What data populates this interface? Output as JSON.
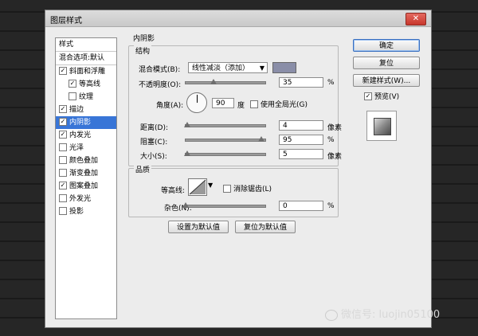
{
  "dialog": {
    "title": "图层样式",
    "close": "✕"
  },
  "styles_list": {
    "header": "样式",
    "blend_default": "混合选项:默认",
    "items": [
      {
        "label": "斜面和浮雕",
        "checked": true,
        "selected": false,
        "indent": 0
      },
      {
        "label": "等高线",
        "checked": true,
        "selected": false,
        "indent": 1
      },
      {
        "label": "纹理",
        "checked": false,
        "selected": false,
        "indent": 1
      },
      {
        "label": "描边",
        "checked": true,
        "selected": false,
        "indent": 0
      },
      {
        "label": "内阴影",
        "checked": true,
        "selected": true,
        "indent": 0
      },
      {
        "label": "内发光",
        "checked": true,
        "selected": false,
        "indent": 0
      },
      {
        "label": "光泽",
        "checked": false,
        "selected": false,
        "indent": 0
      },
      {
        "label": "颜色叠加",
        "checked": false,
        "selected": false,
        "indent": 0
      },
      {
        "label": "渐变叠加",
        "checked": false,
        "selected": false,
        "indent": 0
      },
      {
        "label": "图案叠加",
        "checked": true,
        "selected": false,
        "indent": 0
      },
      {
        "label": "外发光",
        "checked": false,
        "selected": false,
        "indent": 0
      },
      {
        "label": "投影",
        "checked": false,
        "selected": false,
        "indent": 0
      }
    ]
  },
  "inner_shadow": {
    "title": "内阴影",
    "structure": {
      "title": "结构",
      "blend_mode_label": "混合模式(B):",
      "blend_mode_value": "线性减淡（添加）",
      "swatch_color": "#8a8ea8",
      "opacity_label": "不透明度(O):",
      "opacity_value": "35",
      "opacity_unit": "%",
      "opacity_level": 0.35,
      "angle_label": "角度(A):",
      "angle_value": "90",
      "angle_unit": "度",
      "global_light_label": "使用全局光(G)",
      "global_light_checked": false,
      "distance_label": "距离(D):",
      "distance_value": "4",
      "distance_unit": "像素",
      "distance_level": 0.02,
      "choke_label": "阻塞(C):",
      "choke_value": "95",
      "choke_unit": "%",
      "choke_level": 0.95,
      "size_label": "大小(S):",
      "size_value": "5",
      "size_unit": "像素",
      "size_level": 0.02
    },
    "quality": {
      "title": "品质",
      "contour_label": "等高线:",
      "antialias_label": "消除锯齿(L)",
      "antialias_checked": false,
      "noise_label": "杂色(N):",
      "noise_value": "0",
      "noise_unit": "%",
      "noise_level": 0
    },
    "set_default_label": "设置为默认值",
    "reset_default_label": "复位为默认值"
  },
  "buttons": {
    "ok": "确定",
    "reset": "复位",
    "new_style": "新建样式(W)...",
    "preview_label": "预览(V)",
    "preview_checked": true
  },
  "watermark": "微信号: luojin05100"
}
